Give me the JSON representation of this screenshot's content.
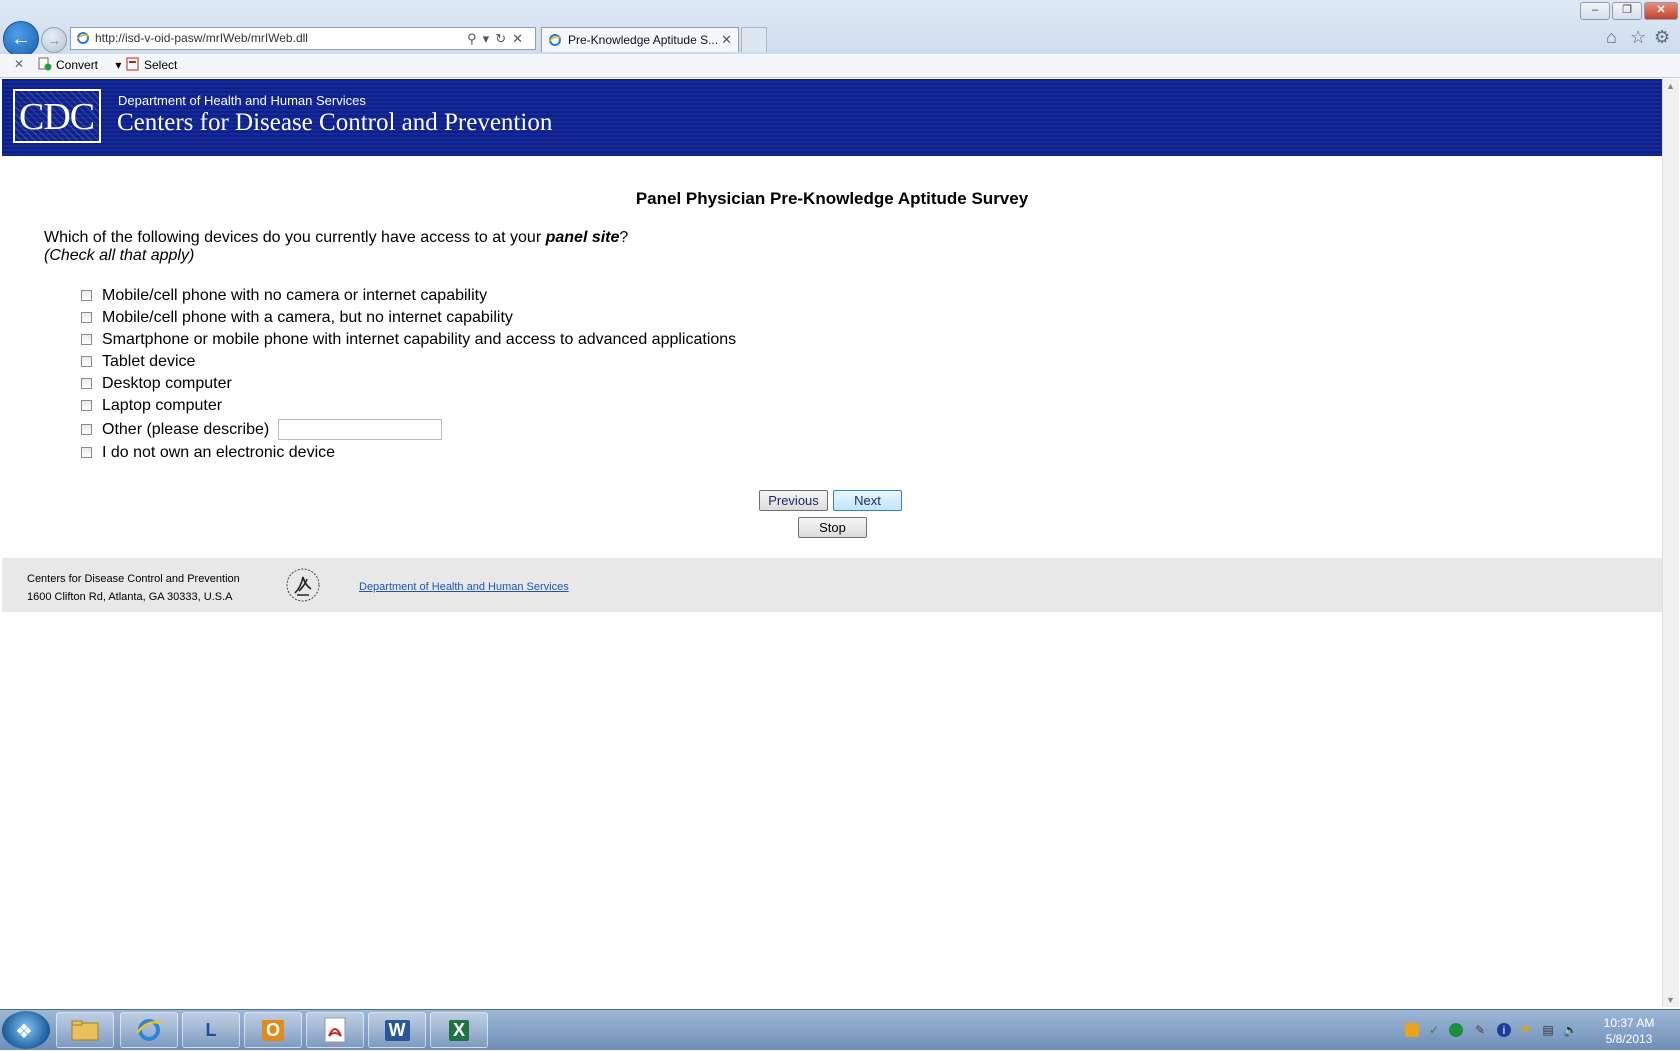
{
  "browser": {
    "url": "http://isd-v-oid-pasw/mrIWeb/mrIWeb.dll",
    "tab_title": "Pre-Knowledge Aptitude S...",
    "tab_close": "✕",
    "window_buttons": {
      "minimize": "–",
      "maximize": "❐",
      "close": "✕"
    },
    "command_bar": {
      "close": "✕",
      "convert_label": "Convert",
      "select_label": "Select"
    }
  },
  "header": {
    "logo_text": "CDC",
    "department": "Department of Health and Human Services",
    "agency": "Centers for Disease Control and Prevention",
    "banner_color": "#0d1f88"
  },
  "survey": {
    "title": "Panel Physician Pre-Knowledge Aptitude Survey",
    "question_prefix": "Which of the following devices do you currently have access to at your ",
    "question_emphasis": "panel site",
    "question_suffix": "?",
    "question_note": "(Check all that apply)",
    "options": [
      "Mobile/cell phone with no camera or internet capability",
      "Mobile/cell phone with a camera, but no internet capability",
      "Smartphone or mobile phone with internet capability and access to advanced applications",
      "Tablet device",
      "Desktop computer",
      "Laptop computer",
      "Other (please describe)",
      "I do not own an electronic device"
    ],
    "other_value": ""
  },
  "buttons": {
    "previous": "Previous",
    "next": "Next",
    "stop": "Stop"
  },
  "footer": {
    "org_name": "Centers for Disease Control and Prevention",
    "address": "1600 Clifton Rd, Atlanta, GA 30333, U.S.A",
    "link_text": "Department of Health and Human Services"
  },
  "taskbar": {
    "apps": [
      "file-explorer",
      "internet-explorer",
      "lync",
      "outlook",
      "acrobat",
      "word",
      "excel"
    ],
    "app_labels": {
      "word": "W",
      "excel": "X",
      "lync": "L",
      "outlook": "O"
    },
    "time": "10:37 AM",
    "date": "5/8/2013"
  }
}
